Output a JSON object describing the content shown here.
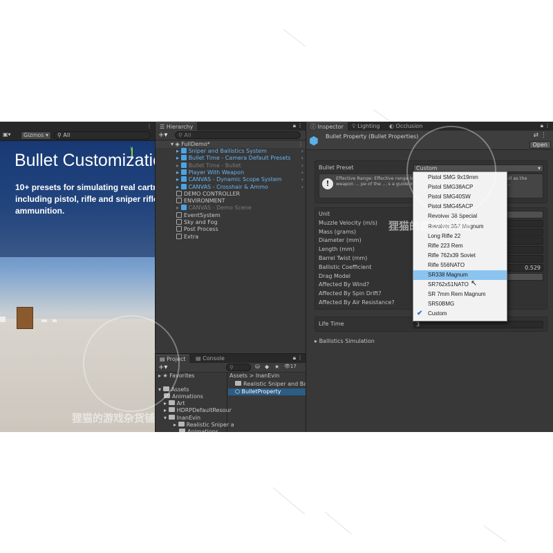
{
  "scene": {
    "gizmos_label": "Gizmos",
    "search_placeholder": "All",
    "overlay_title": "Bullet Customization",
    "overlay_description": "10+ presets for simulating real cartridges including pistol, rifle and sniper rifle ammunition."
  },
  "hierarchy": {
    "tab_label": "Hierarchy",
    "search_placeholder": "All",
    "scene_name": "FullDemo*",
    "items": [
      {
        "label": "Sniper and Ballistics System",
        "style": "blue",
        "chevron": true
      },
      {
        "label": "Bullet Time - Camera Default Presets",
        "style": "blue",
        "chevron": true
      },
      {
        "label": "Bullet Time - Bullet",
        "style": "faded",
        "chevron": true
      },
      {
        "label": "Player With Weapon",
        "style": "blue",
        "chevron": true
      },
      {
        "label": "CANVAS - Dynamic Scope System",
        "style": "blue",
        "chevron": true
      },
      {
        "label": "CANVAS - Crosshair & Ammo",
        "style": "blue",
        "chevron": true
      },
      {
        "label": "DEMO CONTROLLER",
        "style": "normal",
        "chevron": false
      },
      {
        "label": "ENVIRONMENT",
        "style": "normal",
        "chevron": false
      },
      {
        "label": "CANVAS - Demo Scene",
        "style": "faded",
        "chevron": false
      },
      {
        "label": "EventSystem",
        "style": "normal",
        "chevron": false
      },
      {
        "label": "Sky and Fog",
        "style": "normal",
        "chevron": false
      },
      {
        "label": "Post Process",
        "style": "normal",
        "chevron": false
      },
      {
        "label": "Extra",
        "style": "normal",
        "chevron": false
      }
    ]
  },
  "project": {
    "tab_project": "Project",
    "tab_console": "Console",
    "layers_count": "17",
    "favorites_label": "Favorites",
    "assets_label": "Assets",
    "tree": [
      "Animations",
      "Art",
      "HDRPDefaultResour",
      "InanEvin",
      "Realistic Sniper a",
      "Animations"
    ],
    "breadcrumb_root": "Assets",
    "breadcrumb_sep": ">",
    "breadcrumb_leaf": "InanEvin",
    "files": [
      "Realistic Sniper and Balli",
      "BulletProperty"
    ]
  },
  "inspector": {
    "tab_inspector": "Inspector",
    "tab_lighting": "Lighting",
    "tab_occlusion": "Occlusion",
    "title": "Bullet Property (Bullet Properties)",
    "open_button": "Open",
    "bullet_preset_label": "Bullet Preset",
    "bullet_preset_value": "Custom",
    "help_text": "Effective Range: Effective range is an arbitrary concept ... ammunition as well as the weapon ... pe of the ... s a guide in the means of understanding the ammun...",
    "properties": [
      {
        "label": "Unit",
        "value": ""
      },
      {
        "label": "Muzzle Velocity (m/s)",
        "value": ""
      },
      {
        "label": "Mass (grams)",
        "value": ""
      },
      {
        "label": "Diameter (mm)",
        "value": ""
      },
      {
        "label": "Length (mm)",
        "value": ""
      },
      {
        "label": "Barrel Twist (mm)",
        "value": ""
      },
      {
        "label": "Ballistic Coefficient",
        "value": "0.529"
      },
      {
        "label": "Drag Model",
        "value": ""
      },
      {
        "label": "Affected By Wind?",
        "value": ""
      },
      {
        "label": "Affected By Spin Drift?",
        "value": ""
      },
      {
        "label": "Affected By Air Resistance?",
        "value": ""
      }
    ],
    "life_time_label": "Life Time",
    "life_time_value": "3",
    "ballistics_simulation_label": "Ballistics Simulation"
  },
  "preset_dropdown": {
    "options": [
      {
        "label": "Pistol SMG 9x19mm",
        "highlighted": false,
        "checked": false
      },
      {
        "label": "Pistol SMG38ACP",
        "highlighted": false,
        "checked": false
      },
      {
        "label": "Pistol SMG40SW",
        "highlighted": false,
        "checked": false
      },
      {
        "label": "Pistol SMG45ACP",
        "highlighted": false,
        "checked": false
      },
      {
        "label": "Revolver 38 Special",
        "highlighted": false,
        "checked": false
      },
      {
        "label": "Revolver 357 Magnum",
        "highlighted": false,
        "checked": false
      },
      {
        "label": "Long Rifle 22",
        "highlighted": false,
        "checked": false
      },
      {
        "label": "Rifle 223 Rem",
        "highlighted": false,
        "checked": false
      },
      {
        "label": "Rifle 762x39 Soviet",
        "highlighted": false,
        "checked": false
      },
      {
        "label": "Rifle 556NATO",
        "highlighted": false,
        "checked": false
      },
      {
        "label": "SR338 Magnum",
        "highlighted": true,
        "checked": false
      },
      {
        "label": "SR762x51NATO",
        "highlighted": false,
        "checked": false
      },
      {
        "label": "SR 7mm Rem Magnum",
        "highlighted": false,
        "checked": false
      },
      {
        "label": "SR50BMG",
        "highlighted": false,
        "checked": false
      },
      {
        "label": "Custom",
        "highlighted": false,
        "checked": true
      }
    ]
  },
  "watermark": {
    "text": "狸猫的游戏杂货铺"
  },
  "colors": {
    "highlight": "#8cc4f0",
    "selection": "#2c5d87",
    "prefab_blue": "#6ab3f0",
    "panel_bg": "#383838"
  }
}
